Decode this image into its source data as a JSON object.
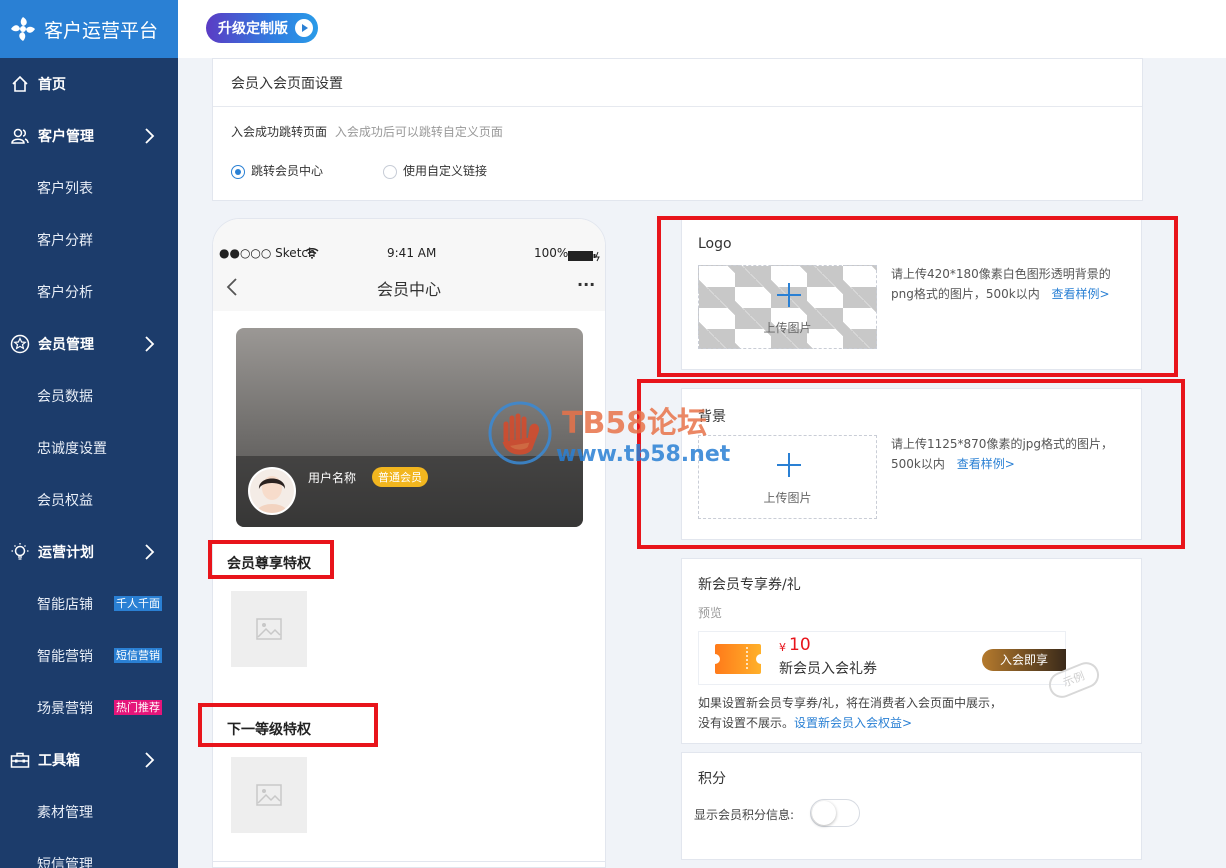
{
  "brand": {
    "title": "客户运营平台"
  },
  "topbar": {
    "upgrade_label": "升级定制版"
  },
  "nav": {
    "home": "首页",
    "customer": "客户管理",
    "customer_list": "客户列表",
    "customer_group": "客户分群",
    "customer_analysis": "客户分析",
    "member": "会员管理",
    "member_data": "会员数据",
    "loyalty": "忠诚度设置",
    "member_rights": "会员权益",
    "ops": "运营计划",
    "smart_store": "智能店铺",
    "smart_store_badge": "千人千面",
    "smart_marketing": "智能营销",
    "smart_marketing_badge": "短信营销",
    "scene_marketing": "场景营销",
    "scene_marketing_badge": "热门推荐",
    "toolbox": "工具箱",
    "material": "素材管理",
    "sms": "短信管理"
  },
  "settings": {
    "title": "会员入会页面设置",
    "redirect_label": "入会成功跳转页面",
    "redirect_hint": "入会成功后可以跳转自定义页面",
    "option_member_center": "跳转会员中心",
    "option_custom_link": "使用自定义链接"
  },
  "phone": {
    "carrier": "●●○○○ Sketch",
    "time": "9:41 AM",
    "battery": "100%",
    "page_title": "会员中心",
    "more": "···",
    "username": "用户名称",
    "level_badge": "普通会员",
    "privilege_title": "会员尊享特权",
    "next_level_title": "下一等级特权"
  },
  "logo_section": {
    "title": "Logo",
    "upload_label": "上传图片",
    "hint": "请上传420*180像素白色图形透明背景的png格式的图片，500k以内",
    "link": "查看样例>"
  },
  "bg_section": {
    "title": "背景",
    "upload_label": "上传图片",
    "hint": "请上传1125*870像素的jpg格式的图片，500k以内",
    "link": "查看样例>"
  },
  "coupon_section": {
    "title": "新会员专享券/礼",
    "preview": "预览",
    "currency": "¥",
    "amount": "10",
    "coupon_name": "新会员入会礼券",
    "join_button": "入会即享",
    "stamp": "示例",
    "desc": "如果设置新会员专享券/礼，将在消费者入会页面中展示，没有设置不展示。",
    "desc_link": "设置新会员入会权益>"
  },
  "points_section": {
    "title": "积分",
    "toggle_label": "显示会员积分信息:"
  },
  "watermark": {
    "line1": "TB58论坛",
    "line2": "www.tb58.net"
  },
  "colors": {
    "sidebar": "#1c3c6b",
    "brand": "#2a80d4",
    "accent": "#2a80d4",
    "highlight": "#e8141b"
  }
}
